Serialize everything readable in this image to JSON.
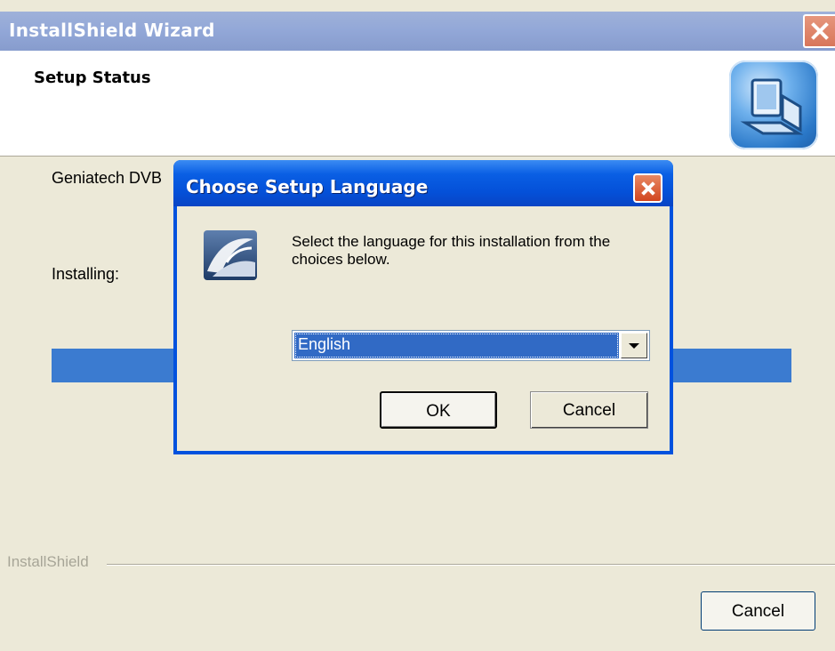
{
  "wizard": {
    "title": "InstallShield Wizard",
    "header_title": "Setup Status",
    "description": "Geniatech DVB",
    "installing_label": "Installing:",
    "brand": "InstallShield",
    "cancel_label": "Cancel",
    "header_icon": "computer-setup-icon"
  },
  "dialog": {
    "title": "Choose Setup Language",
    "message": "Select the language for this installation from the choices below.",
    "language_selected": "English",
    "ok_label": "OK",
    "cancel_label": "Cancel",
    "icon": "installshield-logo-icon"
  },
  "colors": {
    "wizard_titlebar": "#93A8D8",
    "dialog_titlebar": "#0450D8",
    "progress": "#3B7BD0",
    "close_button": "#D8765B",
    "window_face": "#ECE9D8"
  }
}
